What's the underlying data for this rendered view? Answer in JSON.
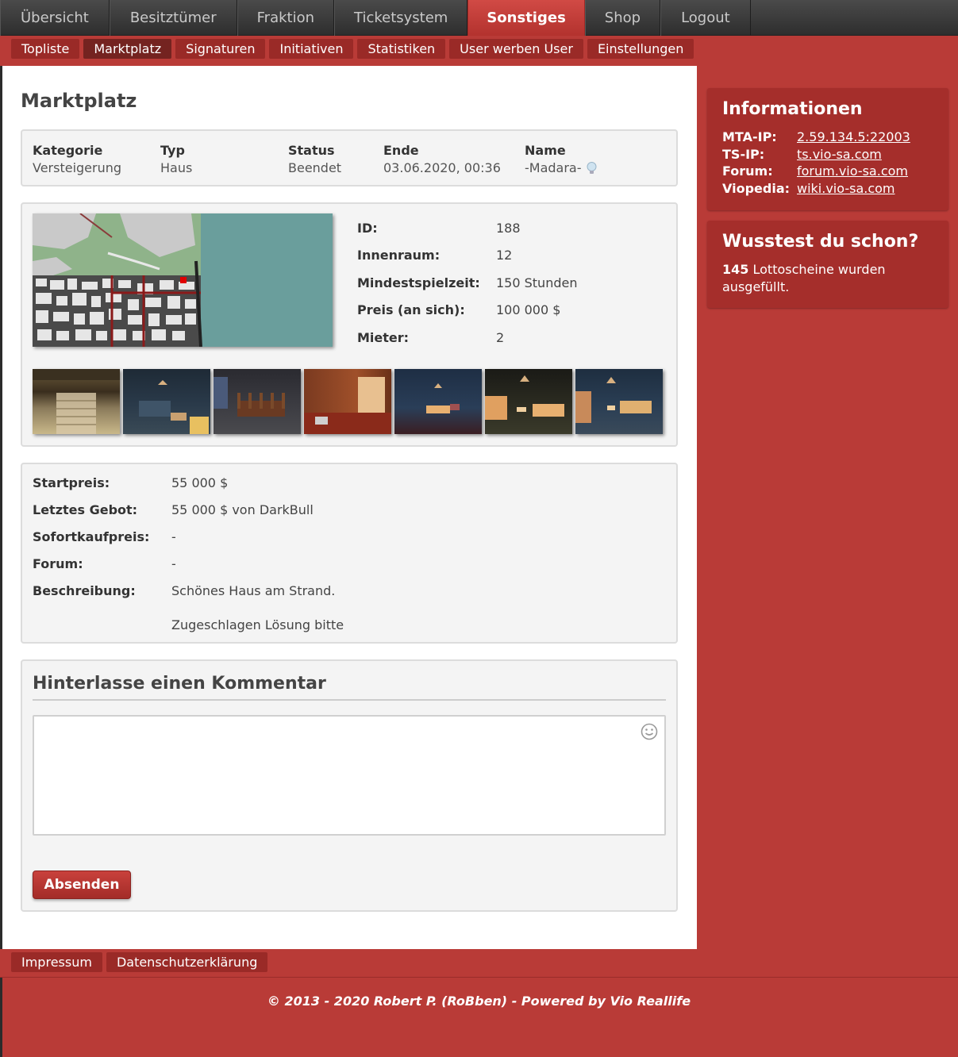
{
  "topnav": {
    "tabs": [
      {
        "label": "Übersicht",
        "active": false
      },
      {
        "label": "Besitztümer",
        "active": false
      },
      {
        "label": "Fraktion",
        "active": false
      },
      {
        "label": "Ticketsystem",
        "active": false
      },
      {
        "label": "Sonstiges",
        "active": true
      },
      {
        "label": "Shop",
        "active": false
      },
      {
        "label": "Logout",
        "active": false
      }
    ]
  },
  "subnav": {
    "items": [
      {
        "label": "Topliste",
        "active": false
      },
      {
        "label": "Marktplatz",
        "active": true
      },
      {
        "label": "Signaturen",
        "active": false
      },
      {
        "label": "Initiativen",
        "active": false
      },
      {
        "label": "Statistiken",
        "active": false
      },
      {
        "label": "User werben User",
        "active": false
      },
      {
        "label": "Einstellungen",
        "active": false
      }
    ]
  },
  "page": {
    "title": "Marktplatz"
  },
  "listing": {
    "kategorie_label": "Kategorie",
    "kategorie": "Versteigerung",
    "typ_label": "Typ",
    "typ": "Haus",
    "status_label": "Status",
    "status": "Beendet",
    "ende_label": "Ende",
    "ende": "03.06.2020, 00:36",
    "name_label": "Name",
    "name": "-Madara-"
  },
  "details": {
    "id_label": "ID:",
    "id": "188",
    "innenraum_label": "Innenraum:",
    "innenraum": "12",
    "mindestspielzeit_label": "Mindestspielzeit:",
    "mindestspielzeit": "150 Stunden",
    "preis_label": "Preis (an sich):",
    "preis": "100 000 $",
    "mieter_label": "Mieter:",
    "mieter": "2"
  },
  "pricing": {
    "startpreis_label": "Startpreis:",
    "startpreis": "55 000 $",
    "letztes_gebot_label": "Letztes Gebot:",
    "letztes_gebot": "55 000 $ von DarkBull",
    "sofortkauf_label": "Sofortkaufpreis:",
    "sofortkauf": "-",
    "forum_label": "Forum:",
    "forum": "-",
    "beschreibung_label": "Beschreibung:",
    "beschreibung_line1": "Schönes Haus am Strand.",
    "beschreibung_line2": "Zugeschlagen Lösung bitte"
  },
  "comment": {
    "title": "Hinterlasse einen Kommentar",
    "textarea_value": "",
    "submit_label": "Absenden"
  },
  "sidebar": {
    "info_title": "Informationen",
    "mta_label": "MTA-IP:",
    "mta": "2.59.134.5:22003",
    "ts_label": "TS-IP:",
    "ts": "ts.vio-sa.com",
    "forum_label": "Forum:",
    "forum": "forum.vio-sa.com",
    "viopedia_label": "Viopedia:",
    "viopedia": "wiki.vio-sa.com",
    "fact_title": "Wusstest du schon?",
    "fact_count": "145",
    "fact_line1": " Lottoscheine wurden",
    "fact_line2": "ausgefüllt."
  },
  "footer": {
    "links": [
      "Impressum",
      "Datenschutzerklärung"
    ],
    "copyright": "© 2013 - 2020 Robert P. (RoBben) - Powered by Vio Reallife"
  },
  "colors": {
    "accent": "#b93b37",
    "dark_nav": "#3a3a3a"
  }
}
